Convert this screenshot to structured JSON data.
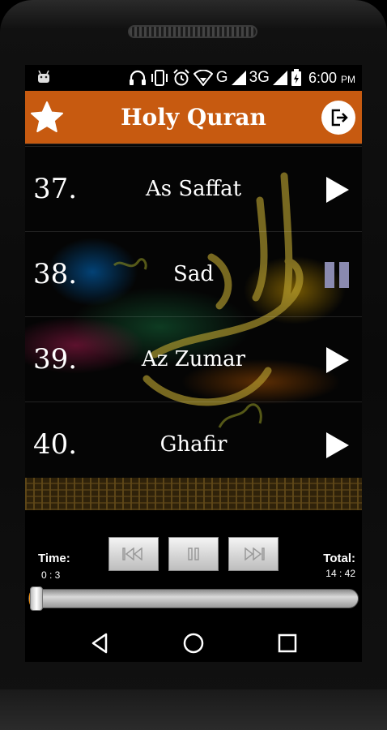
{
  "status_bar": {
    "network_g": "G",
    "network_3g": "3G",
    "time": "6:00",
    "ampm": "PM"
  },
  "header": {
    "title": "Holy Quran",
    "accent_color": "#c75a10"
  },
  "surahs": [
    {
      "number": "37.",
      "name": "As Saffat",
      "state": "play"
    },
    {
      "number": "38.",
      "name": "Sad",
      "state": "pause"
    },
    {
      "number": "39.",
      "name": "Az Zumar",
      "state": "play"
    },
    {
      "number": "40.",
      "name": "Ghafir",
      "state": "play"
    }
  ],
  "player": {
    "time_label": "Time:",
    "time_value": "0 : 3",
    "total_label": "Total:",
    "total_value": "14 : 42",
    "progress_fraction": 0.003
  },
  "icons": {
    "status": [
      "android-icon",
      "headphones-icon",
      "vibrate-icon",
      "alarm-icon",
      "wifi-icon",
      "signal-icon",
      "battery-charging-icon"
    ],
    "header": [
      "star-icon",
      "exit-icon"
    ],
    "player": [
      "previous-icon",
      "pause-icon",
      "next-icon"
    ],
    "nav": [
      "back-icon",
      "home-icon",
      "recents-icon"
    ]
  }
}
